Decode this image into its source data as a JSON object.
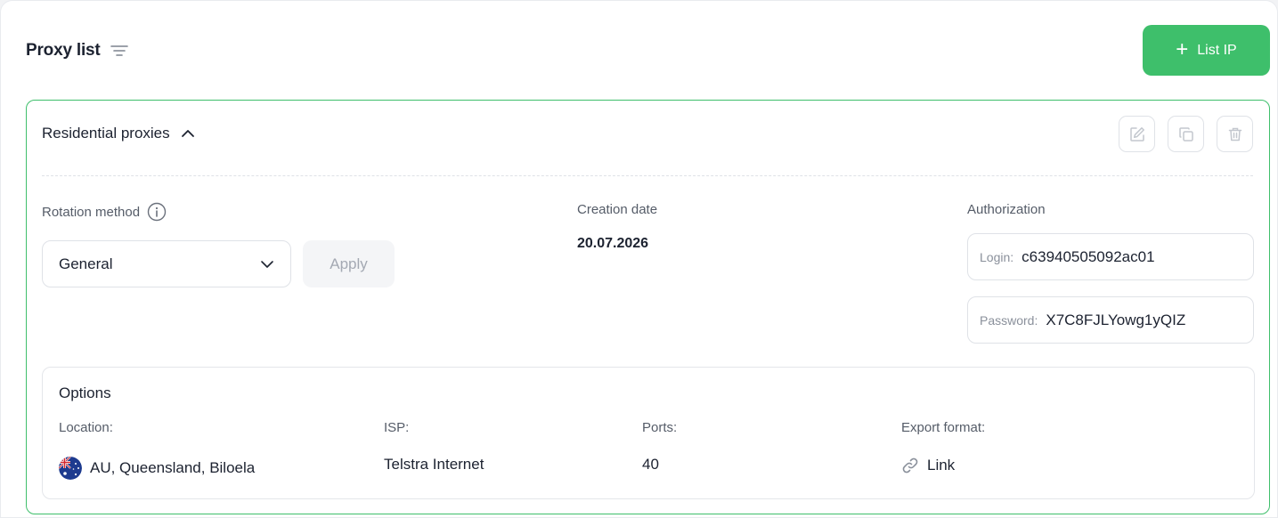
{
  "header": {
    "title": "Proxy list",
    "list_ip_label": "List IP"
  },
  "card": {
    "title": "Residential proxies",
    "rotation": {
      "label": "Rotation method",
      "selected": "General",
      "apply_label": "Apply"
    },
    "creation": {
      "label": "Creation date",
      "value": "20.07.2026"
    },
    "authorization": {
      "label": "Authorization",
      "login_key": "Login:",
      "login_value": "c63940505092ac01",
      "password_key": "Password:",
      "password_value": "X7C8FJLYowg1yQIZ"
    },
    "options": {
      "title": "Options",
      "location_label": "Location:",
      "location_value": "AU, Queensland, Biloela",
      "isp_label": "ISP:",
      "isp_value": "Telstra Internet",
      "ports_label": "Ports:",
      "ports_value": "40",
      "export_label": "Export format:",
      "export_value": "Link"
    }
  },
  "colors": {
    "accent": "#3ebf6b",
    "border": "#dfe2e7",
    "text": "#1c2230",
    "muted": "#555c68"
  }
}
